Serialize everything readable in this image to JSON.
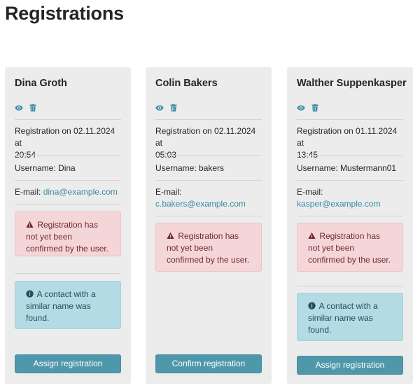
{
  "page": {
    "title": "Registrations"
  },
  "labels": {
    "registration_prefix": "Registration on",
    "username_prefix": "Username:",
    "email_prefix": "E-mail:"
  },
  "cards": [
    {
      "name": "Dina Groth",
      "registration_line1": "Registration on 02.11.2024 at",
      "registration_line2": "20:54",
      "username": "Username: Dina",
      "email_label": "E-mail:",
      "email": "dina@example.com",
      "warning": "Registration has not yet been confirmed by the user.",
      "info": "A contact with a similar name was found.",
      "button": "Assign registration"
    },
    {
      "name": "Colin Bakers",
      "registration_line1": "Registration on 02.11.2024 at",
      "registration_line2": "05:03",
      "username": "Username: bakers",
      "email_label": "E-mail:",
      "email": "c.bakers@example.com",
      "warning": "Registration has not yet been confirmed by the user.",
      "button": "Confirm registration"
    },
    {
      "name": "Walther Suppenkasper",
      "registration_line1": "Registration on 01.11.2024 at",
      "registration_line2": "13:45",
      "username": "Username: Mustermann01",
      "email_label": "E-mail:",
      "email": "kasper@example.com",
      "warning": "Registration has not yet been confirmed by the user.",
      "info": "A contact with a similar name was found.",
      "button": "Assign registration"
    }
  ],
  "icons": {
    "view": "eye-icon",
    "delete": "trash-icon",
    "warning": "warning-triangle-icon",
    "info": "info-circle-icon"
  },
  "colors": {
    "accent": "#4f98ac",
    "link": "#3a8ca3",
    "danger_bg": "#f5d6d8",
    "info_bg": "#b3dbe4",
    "card_bg": "#ececec"
  }
}
